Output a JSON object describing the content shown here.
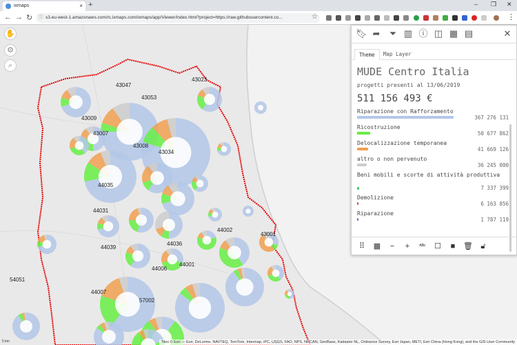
{
  "browser": {
    "tab_title": "ixmaps",
    "tab_close": "×",
    "new_tab": "+",
    "url": "s3.eu-west-1.amazonaws.com/rc.ixmaps.com/ixmaps/app/Viewer/index.html?project=https://raw.githubusercontent.co...",
    "window_controls": {
      "minimize": "–",
      "maximize": "❐",
      "close": "✕"
    }
  },
  "map": {
    "attribution": "Tiles © Esri — Esri, DeLorme, NAVTEQ, TomTom, Intermap, iPC, USGS, FAO, NPS, NRCAN, GeoBase, Kadaster NL, Ordnance Survey, Esri Japan, METI, Esri China (Hong Kong), and the GIS User Community",
    "scale_label": "5 km",
    "codes": [
      "43047",
      "43023",
      "43053",
      "43007",
      "43009",
      "43034",
      "43008",
      "44035",
      "44036",
      "44031",
      "44002",
      "44001",
      "44006",
      "44007",
      "54051",
      "57002",
      "43001",
      "44039"
    ],
    "colors": {
      "riparazione_rafforzamento": "#b3c7e8",
      "ricostruzione": "#66ee44",
      "delocalizzazione": "#f0a050",
      "altro": "#cccccc",
      "beni_mobili": "#44cc66",
      "demolizione": "#dd4444",
      "riparazione": "#5577cc",
      "boundary": "#e60000"
    }
  },
  "panel": {
    "tabs": [
      "Theme",
      "Map Layer"
    ],
    "title": "MUDE Centro Italia",
    "subtitle": "progetti presenti al 13/06/2019",
    "total": "511 156 493 €",
    "items": [
      {
        "label": "Riparazione con Rafforzamento",
        "value": "367 276 131",
        "share": 0.7185,
        "color": "#b3c7e8"
      },
      {
        "label": "Ricostruzione",
        "value": "50 677 862",
        "share": 0.0991,
        "color": "#66ee44"
      },
      {
        "label": "Delocalizzazione temporanea",
        "value": "41 669 126",
        "share": 0.0815,
        "color": "#f0a050"
      },
      {
        "label": "altro o non pervenuto",
        "value": "36 245 000",
        "share": 0.0709,
        "color": "#cccccc"
      },
      {
        "label": "Beni mobili e scorte di attività produttiva",
        "value": "7 337 399",
        "share": 0.0144,
        "color": "#44cc66"
      },
      {
        "label": "Demolizione",
        "value": "6 163 856",
        "share": 0.0121,
        "color": "#dd4444"
      },
      {
        "label": "Riparazione",
        "value": "1 787 119",
        "share": 0.0035,
        "color": "#5577cc"
      }
    ]
  }
}
